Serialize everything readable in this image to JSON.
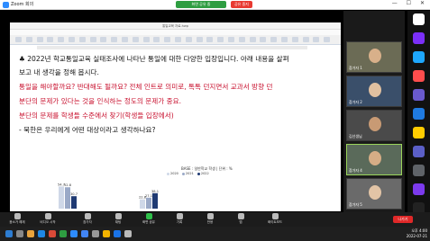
{
  "zoom": {
    "title": "Zoom 회의",
    "share_banner": "화면 공유 중",
    "stop_share": "공유 중지",
    "window_controls": "— ☐ ✕"
  },
  "document": {
    "title": "통일교육 자료.hwp",
    "ribbon_tabs": [
      "파일",
      "편집",
      "보기",
      "입력",
      "서식",
      "쪽",
      "보안",
      "검토",
      "도구"
    ],
    "lines": [
      {
        "text": "♣ 2022년 학교통일교육 실태조사에 나타난 통일에 대한 다양한 입장입니다. 아래 내용을 살펴",
        "color": "black"
      },
      {
        "text": "보고 내 생각을 정해 봅시다.",
        "color": "black"
      },
      {
        "text": "통일을 해야할까요? 반대해도 될까요? 전체 인트로 의미로, 톡톡 던지면서 교과서 방향 던",
        "color": "red"
      },
      {
        "text": "분단의 문제가 있다는 것을 인식하는 정도의 문제가 중요.",
        "color": "red"
      },
      {
        "text": "분단의 문제를 학생들 수준에서 찾기(학생들 입장에서)",
        "color": "red"
      },
      {
        "text": "- 북한은 우리에게 어떤 대상이라고 생각하나요?",
        "color": "black"
      }
    ]
  },
  "chart_data": {
    "type": "bar",
    "caption": "BASE : 일반학교 학생 | 단위 : %",
    "series": [
      {
        "name": "2020",
        "color": "#cfd8e8",
        "values": [
          54.7,
          22.8
        ]
      },
      {
        "name": "2021",
        "color": "#9aa9c7",
        "values": [
          52.8,
          27.1
        ]
      },
      {
        "name": "2022",
        "color": "#1f3a73",
        "values": [
          30.7,
          38.1
        ]
      }
    ],
    "labels": [
      [
        "54.7",
        "52.8",
        "30.7"
      ],
      [
        "22.8",
        "27.1",
        "38.1"
      ]
    ]
  },
  "participants": [
    {
      "name": "참가자 1",
      "bg": "#6b6b55",
      "face": "#d8b08a"
    },
    {
      "name": "참가자 2",
      "bg": "#3a4f6a",
      "face": "#e0c0a0"
    },
    {
      "name": "김선생님",
      "bg": "#4a4a4a",
      "face": "#c89a74"
    },
    {
      "name": "참가자 4",
      "bg": "#5a6a5a",
      "face": "#d6ad86"
    },
    {
      "name": "참가자 5",
      "bg": "#6a6a6a",
      "face": "#e2c4a6"
    }
  ],
  "meeting_bar": [
    "음소거 해제",
    "비디오 시작",
    "참가자",
    "채팅",
    "화면 공유",
    "기록",
    "반응",
    "앱",
    "화이트보드"
  ],
  "end_label": "나가기",
  "clock": {
    "time": "오후 4:00",
    "date": "2022-07-21"
  }
}
